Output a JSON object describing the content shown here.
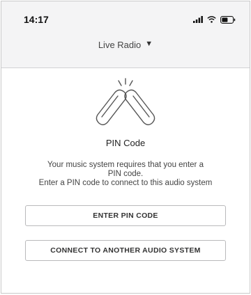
{
  "status_bar": {
    "time": "14:17",
    "icons": [
      "signal-icon",
      "wifi-icon",
      "battery-icon"
    ]
  },
  "header": {
    "title": "Live Radio",
    "dropdown_icon": "▼"
  },
  "main": {
    "illustration": "connection-link-icon",
    "heading": "PIN Code",
    "description_line1": "Your music system requires that you enter a",
    "description_line2": "PIN code.",
    "description_line3": "Enter a PIN code to connect to this audio system",
    "primary_button": "ENTER PIN CODE",
    "secondary_button": "CONNECT TO ANOTHER AUDIO SYSTEM"
  }
}
